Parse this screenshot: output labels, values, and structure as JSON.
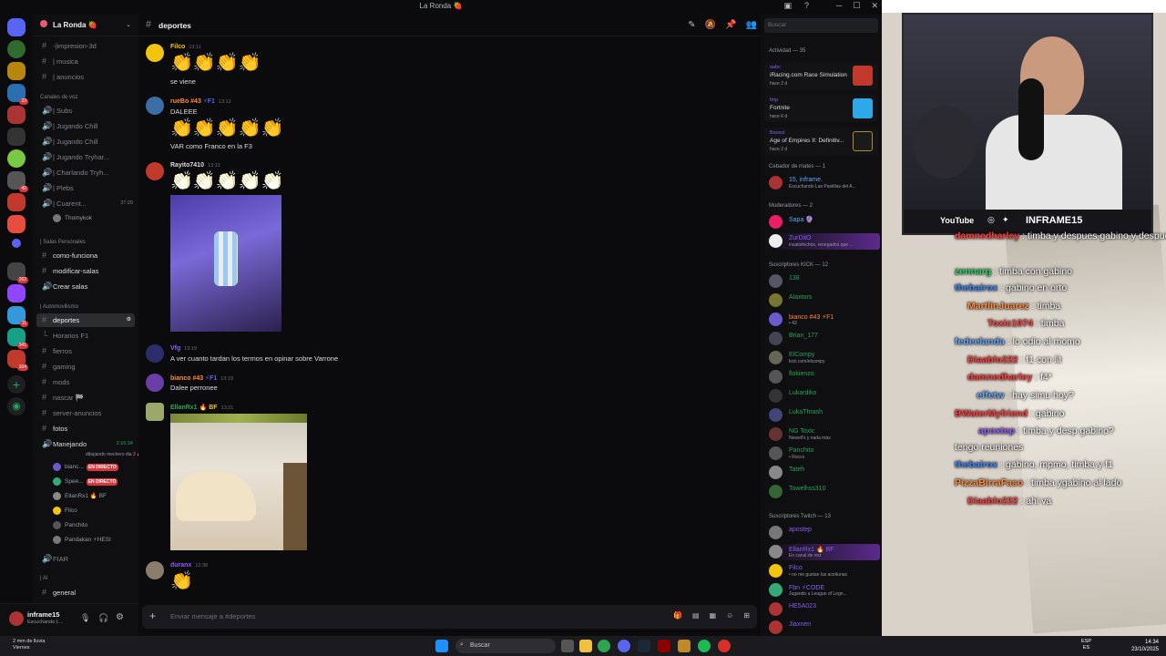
{
  "window": {
    "title": "La Ronda 🍓"
  },
  "guild": {
    "name": "La Ronda 🍓"
  },
  "channels": {
    "top": [
      {
        "label": "-|impresion-3d"
      },
      {
        "label": "| musica"
      },
      {
        "label": "| anuncios"
      }
    ],
    "voice_category": "Canales de voz",
    "voice": [
      {
        "label": "| Subs"
      },
      {
        "label": "| Jugando Chill"
      },
      {
        "label": "| Jugando Chill"
      },
      {
        "label": "| Jugando Tryhar..."
      },
      {
        "label": "| Charlando Tryh..."
      },
      {
        "label": "| Plebs"
      },
      {
        "label": "| Cuarent...",
        "time": "37:20"
      }
    ],
    "voice_user": "Thomykok",
    "salas_category": "| Salas Personales",
    "salas": [
      {
        "label": "como-funciona"
      },
      {
        "label": "modificar-salas"
      },
      {
        "label": "Crear salas"
      }
    ],
    "auto_category": "| Automovilismo",
    "auto": [
      {
        "label": "deportes"
      },
      {
        "label": "Horarios F1"
      },
      {
        "label": "fierros"
      },
      {
        "label": "gaming"
      },
      {
        "label": "mods"
      },
      {
        "label": "nascar 🏁"
      },
      {
        "label": "server-anuncios"
      },
      {
        "label": "fotos"
      }
    ],
    "manejando": {
      "label": "Manejando",
      "time": "2:16:34",
      "status": "dibujando mechero dia 3 🔥"
    },
    "manejando_users": [
      {
        "name": "bianc...",
        "live": "EN DIRECTO"
      },
      {
        "name": "Spee...",
        "live": "EN DIRECTO"
      },
      {
        "name": "EllanRx1 🔥 BF"
      },
      {
        "name": "Filco"
      },
      {
        "name": "Panchito"
      },
      {
        "name": "Pandakan ⚡HESI"
      }
    ],
    "fiar": "FIAR",
    "ai_category": "| AI",
    "general": "general"
  },
  "user_panel": {
    "name": "inframe15",
    "status": "Escuchando L..."
  },
  "chat": {
    "channel": "deportes",
    "composer_placeholder": "Enviar mensaje a #deportes",
    "messages": [
      {
        "author": "Filco",
        "time": "13:11",
        "emoji": "👏👏👏👏",
        "text": "se viene"
      },
      {
        "author": "rueBo #43",
        "tag": "⚡F1",
        "time": "13:12",
        "emoji": "👏👏👏👏👏",
        "text": "DALEEE",
        "text2": "VAR como Franco en la F3"
      },
      {
        "author": "Rayito7410",
        "time": "13:13",
        "emoji": "👏👏👏👏👏"
      },
      {
        "author": "Vfg",
        "time": "13:19",
        "text": "A ver cuanto tardan los termos en opinar sobre Varrone"
      },
      {
        "author": "bianco #43",
        "tag": "⚡F1",
        "time": "13:19",
        "text": "Dalee perronee"
      },
      {
        "author": "EllanRx1",
        "tag": "🔥 BF",
        "time": "13:21"
      },
      {
        "author": "duranx",
        "time": "13:38",
        "emoji": "👏"
      }
    ]
  },
  "search": {
    "placeholder": "Buscar"
  },
  "members": {
    "activity_title": "Actividad — 35",
    "activities": [
      {
        "user": "aabc",
        "game": "iRacing.com Race Simulation",
        "when": "hace 2 d"
      },
      {
        "user": "fmp",
        "game": "Fortnite",
        "when": "hace 6 d"
      },
      {
        "user": "Baxsol",
        "game": "Age of Empires II: Definitiv...",
        "when": "hace 2 d"
      }
    ],
    "cebador_cat": "Cebador de mates — 1",
    "cebador": [
      {
        "name": "15, inframe.",
        "sub": "Escuchando Las Pastillas del A..."
      }
    ],
    "mods_cat": "Moderadores — 2",
    "mods": [
      {
        "name": "Sapa 🔮"
      },
      {
        "name": "ZurDitO",
        "sub": "insatisfechos, renegados que ..."
      }
    ],
    "kick_cat": "Suscriptores KICK — 12",
    "kick": [
      {
        "name": "138"
      },
      {
        "name": "Alaxtors"
      },
      {
        "name": "bianco #43 ⚡F1",
        "sub": "• 43"
      },
      {
        "name": "Brian_177"
      },
      {
        "name": "ElCompy",
        "sub": "kick.com/elcompy"
      },
      {
        "name": "flokienzo"
      },
      {
        "name": "Lukardiko"
      },
      {
        "name": "LukaThrash"
      },
      {
        "name": "NG Toxic",
        "sub": "Newell's y nada más"
      },
      {
        "name": "Panchito",
        "sub": "• Rocco"
      },
      {
        "name": "Tateh"
      },
      {
        "name": "Towelhss310"
      }
    ],
    "twitch_cat": "Suscriptores Twitch — 13",
    "twitch": [
      {
        "name": "apostep"
      },
      {
        "name": "EllanRx1 🔥 BF",
        "sub": "En canal de voz"
      },
      {
        "name": "Filco",
        "sub": "• no me gustan las aceitunas"
      },
      {
        "name": "Fbn ⚡CODE",
        "sub": "Jugando a League of Legn..."
      },
      {
        "name": "HE5A023"
      },
      {
        "name": "Jiaxnen"
      }
    ]
  },
  "stream": {
    "cam_socials": "YouTube",
    "cam_handle": "INFRAME15",
    "chat": [
      {
        "user": "damnedharley",
        "color": "#ff3b3b",
        "text": "timba y despues gabino y despues f1"
      },
      {
        "user": "zennarg",
        "color": "#25d366",
        "text": "timba con gabino"
      },
      {
        "user": "thebairox",
        "color": "#3b82f6",
        "text": "gabino en orto"
      },
      {
        "user": "MartlinJuarez",
        "color": "#ff8a3b",
        "text": "timba"
      },
      {
        "user": "Toxic1974",
        "color": "#ff3b3b",
        "text": "timba"
      },
      {
        "user": "fedeelanda",
        "color": "#60a5fa",
        "text": "lo odio al momo"
      },
      {
        "user": "Diaablo222",
        "color": "#ff3b3b",
        "text": "f1 con lit"
      },
      {
        "user": "damnedharley",
        "color": "#ff3b3b",
        "text": "f4*"
      },
      {
        "user": "effetw",
        "color": "#60a5fa",
        "text": "hay simu hoy?"
      },
      {
        "user": "BWaterMyfriend",
        "color": "#ff3b3b",
        "text": "gabino"
      },
      {
        "user": "apoxtep",
        "color": "#8b5cf6",
        "text": "timba y desp gabino?"
      },
      {
        "user": "",
        "color": "#ffffff",
        "text": "tengo reuniones"
      },
      {
        "user": "thebairox",
        "color": "#3b82f6",
        "text": "gabino, mpmo, timba y f1"
      },
      {
        "user": "PizzaBirraFaso",
        "color": "#ff8a3b",
        "text": "timba ygabino al lado"
      },
      {
        "user": "Diaablo222",
        "color": "#ff3b3b",
        "text": "ahi va"
      }
    ]
  },
  "taskbar": {
    "weather": "2 mm de lluvia",
    "weather_sub": "Viernes",
    "search": "Buscar",
    "lang": "ESP",
    "lang_sub": "ES",
    "time": "14:34",
    "date": "23/10/2025"
  }
}
